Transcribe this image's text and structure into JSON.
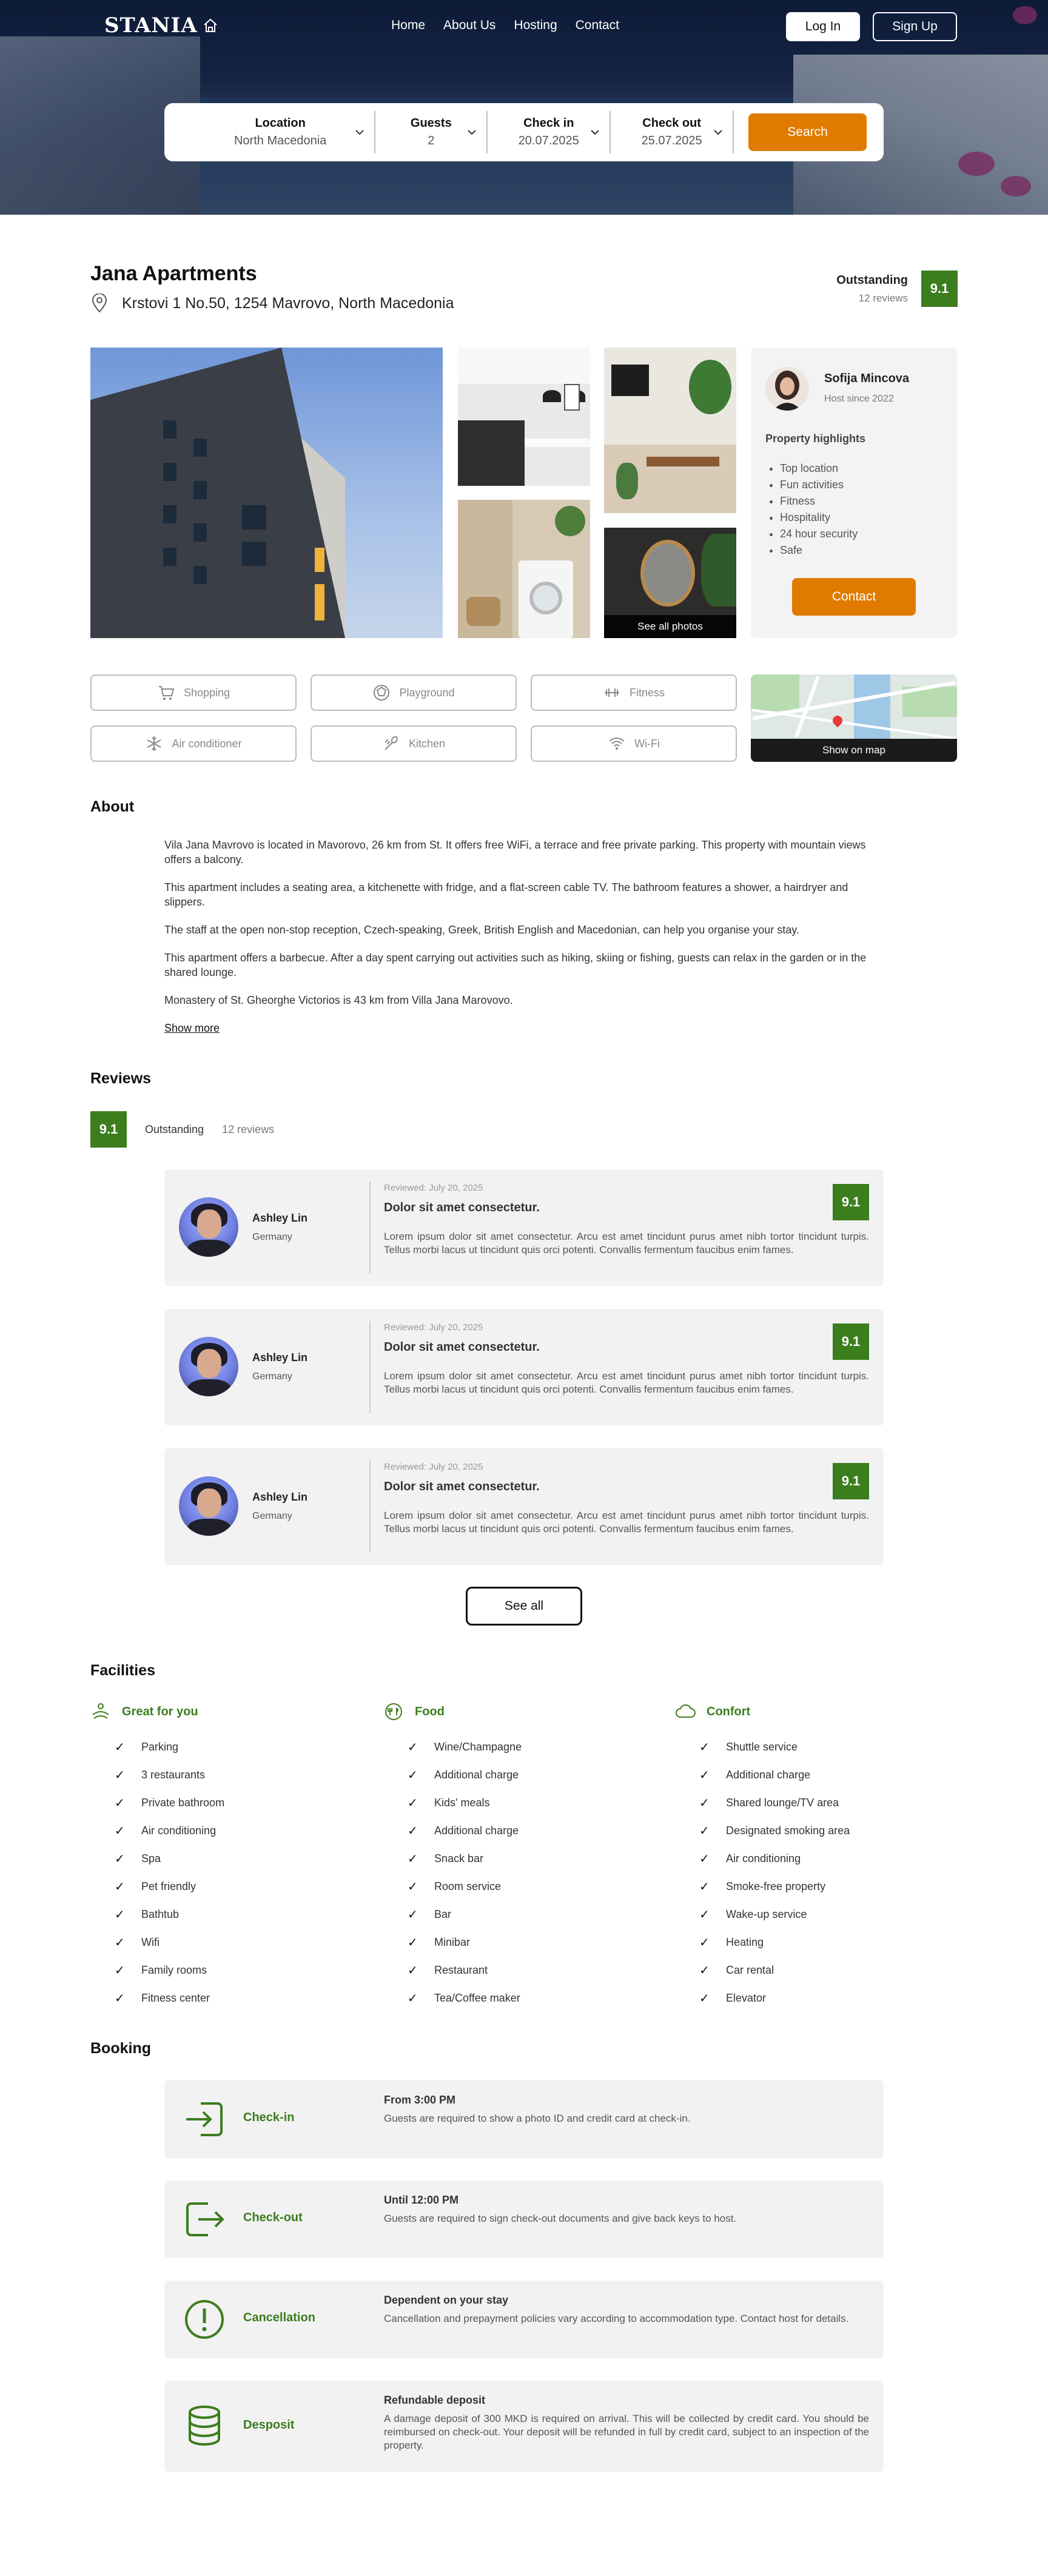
{
  "header": {
    "logo": "STANIA",
    "nav": [
      "Home",
      "About Us",
      "Hosting",
      "Contact"
    ],
    "login": "Log In",
    "signup": "Sign Up"
  },
  "search": {
    "location": {
      "label": "Location",
      "value": "North Macedonia"
    },
    "guests": {
      "label": "Guests",
      "value": "2"
    },
    "checkin": {
      "label": "Check in",
      "value": "20.07.2025"
    },
    "checkout": {
      "label": "Check out",
      "value": "25.07.2025"
    },
    "button": "Search"
  },
  "property": {
    "name": "Jana Apartments",
    "address": "Krstovi 1 No.50, 1254 Mavrovo, North Macedonia",
    "rating_label": "Outstanding",
    "reviews_count": "12 reviews",
    "score": "9.1"
  },
  "gallery": {
    "see_all": "See all photos"
  },
  "host": {
    "name": "Sofija Mincova",
    "since": "Host since 2022",
    "highlights_title": "Property highlights",
    "highlights": [
      "Top location",
      "Fun activities",
      "Fitness",
      "Hospitality",
      "24 hour security",
      "Safe"
    ],
    "contact": "Contact"
  },
  "amenities": [
    {
      "label": "Shopping",
      "icon": "cart-icon"
    },
    {
      "label": "Playground",
      "icon": "ball-icon"
    },
    {
      "label": "Fitness",
      "icon": "dumbbell-icon"
    },
    {
      "label": "Air conditioner",
      "icon": "snowflake-icon"
    },
    {
      "label": "Kitchen",
      "icon": "utensils-icon"
    },
    {
      "label": "Wi-Fi",
      "icon": "wifi-icon"
    }
  ],
  "map": {
    "show": "Show on map"
  },
  "about": {
    "title": "About",
    "paragraphs": [
      "Vila Jana Mavrovo is located in Mavorovo, 26 km from St. It offers free  WiFi, a terrace and free private parking. This property with mountain  views offers a balcony.",
      "This apartment includes a seating area, a kitchenette with fridge, and a flat-screen cable TV. The bathroom features a shower, a hairdryer and  slippers.",
      "The staff at the open non-stop reception, Czech-speaking, Greek, British English and Macedonian, can help you organise your stay.",
      "This apartment offers a barbecue. After a day spent carrying out  activities such as hiking, skiing or fishing, guests can relax in the garden or in the shared lounge.",
      "Monastery of St. Gheorghe Victorios is 43 km from Villa Jana Marovovo."
    ],
    "show_more": "Show more"
  },
  "reviews": {
    "title": "Reviews",
    "score": "9.1",
    "label": "Outstanding",
    "count": "12 reviews",
    "items": [
      {
        "name": "Ashley Lin",
        "country": "Germany",
        "date": "Reviewed: July 20, 2025",
        "title": "Dolor sit amet consectetur.",
        "body": "Lorem ipsum dolor sit amet consectetur. Arcu est amet tincidunt purus amet nibh tortor tincidunt turpis. Tellus morbi lacus ut tincidunt quis orci potenti. Convallis fermentum faucibus enim fames.",
        "score": "9.1"
      },
      {
        "name": "Ashley Lin",
        "country": "Germany",
        "date": "Reviewed: July 20, 2025",
        "title": "Dolor sit amet consectetur.",
        "body": "Lorem ipsum dolor sit amet consectetur. Arcu est amet tincidunt purus amet nibh tortor tincidunt turpis. Tellus morbi lacus ut tincidunt quis orci potenti. Convallis fermentum faucibus enim fames.",
        "score": "9.1"
      },
      {
        "name": "Ashley Lin",
        "country": "Germany",
        "date": "Reviewed: July 20, 2025",
        "title": "Dolor sit amet consectetur.",
        "body": "Lorem ipsum dolor sit amet consectetur. Arcu est amet tincidunt purus amet nibh tortor tincidunt turpis. Tellus morbi lacus ut tincidunt quis orci potenti. Convallis fermentum faucibus enim fames.",
        "score": "9.1"
      }
    ],
    "see_all": "See all"
  },
  "facilities": {
    "title": "Facilities",
    "columns": [
      {
        "title": "Great for you",
        "icon": "spa-icon",
        "items": [
          "Parking",
          "3 restaurants",
          "Private bathroom",
          "Air conditioning",
          "Spa",
          "Pet friendly",
          "Bathtub",
          "Wifi",
          "Family rooms",
          "Fitness center"
        ]
      },
      {
        "title": "Food",
        "icon": "food-icon",
        "items": [
          "Wine/Champagne",
          "Additional charge",
          "Kids' meals",
          "Additional charge",
          "Snack bar",
          "Room service",
          "Bar",
          "Minibar",
          "Restaurant",
          "Tea/Coffee maker"
        ]
      },
      {
        "title": "Confort",
        "icon": "cloud-icon",
        "items": [
          "Shuttle service",
          "Additional charge",
          "Shared lounge/TV area",
          "Designated smoking area",
          "Air conditioning",
          "Smoke-free property",
          "Wake-up service",
          "Heating",
          "Car rental",
          "Elevator"
        ]
      }
    ]
  },
  "booking": {
    "title": "Booking",
    "items": [
      {
        "label": "Check-in",
        "icon": "check-in-icon",
        "title": "From 3:00 PM",
        "desc": "Guests are required to show a photo ID and credit card at check-in."
      },
      {
        "label": "Check-out",
        "icon": "check-out-icon",
        "title": "Until 12:00 PM",
        "desc": "Guests are required to sign check-out documents and give back keys to host."
      },
      {
        "label": "Cancellation",
        "icon": "alert-icon",
        "title": "Dependent on your stay",
        "desc": "Cancellation and prepayment policies vary according to accommodation type. Contact host for details."
      },
      {
        "label": "Desposit",
        "icon": "coins-icon",
        "title": "Refundable deposit",
        "desc": "A damage deposit of 300 MKD is required on arrival. This will be  collected by credit card. You should be reimbursed on check-out. Your deposit will be refunded in full by credit card, subject to an inspection of the property."
      }
    ]
  },
  "colors": {
    "accent": "#e07b00",
    "score": "#3c7d1e"
  }
}
